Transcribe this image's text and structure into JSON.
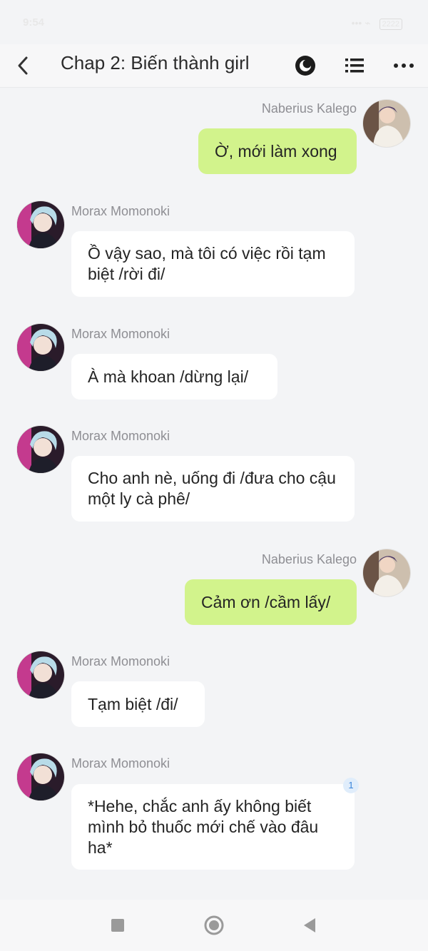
{
  "status_bar": {
    "time": "9:54",
    "signal": "••• ⌁",
    "battery": "2222"
  },
  "header": {
    "title": "Chap 2: Biến thành girl"
  },
  "messages": [
    {
      "side": "right",
      "sender": "Naberius Kalego",
      "text": "Ờ, mới làm xong"
    },
    {
      "side": "left",
      "sender": "Morax Momonoki",
      "text": "Ồ vậy sao, mà tôi có việc rồi tạm biệt /rời đi/"
    },
    {
      "side": "left",
      "sender": "Morax Momonoki",
      "text": "À mà khoan /dừng lại/"
    },
    {
      "side": "left",
      "sender": "Morax Momonoki",
      "text": "Cho anh nè, uống đi /đưa cho cậu một ly cà phê/"
    },
    {
      "side": "right",
      "sender": "Naberius Kalego",
      "text": "Cảm ơn /cầm lấy/"
    },
    {
      "side": "left",
      "sender": "Morax Momonoki",
      "text": "Tạm biệt /đi/"
    },
    {
      "side": "left",
      "sender": "Morax Momonoki",
      "text": "*Hehe, chắc anh ấy không biết mình bỏ thuốc mới chế vào đâu ha*",
      "badge": "1"
    }
  ],
  "colors": {
    "outgoing_bubble": "#d2f38c",
    "incoming_bubble": "#ffffff",
    "background": "#f3f4f6",
    "badge_text": "#3a84d9"
  },
  "icons": {
    "back": "chevron-left-icon",
    "night_mode": "moon-icon",
    "list": "list-icon",
    "more": "more-dots-icon",
    "nav_recent": "square-icon",
    "nav_home": "circle-icon",
    "nav_back": "triangle-back-icon"
  }
}
